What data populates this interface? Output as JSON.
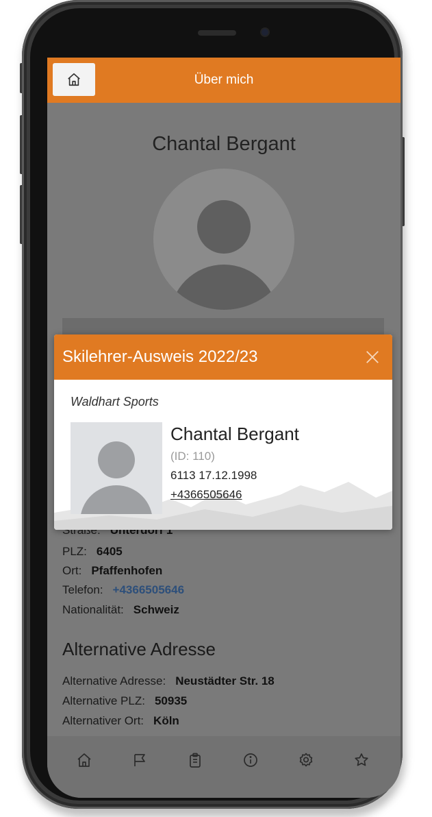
{
  "header": {
    "title": "Über mich"
  },
  "profile": {
    "name": "Chantal Bergant"
  },
  "details": {
    "street_label": "Straße:",
    "street_value": "Unterdorf 1",
    "zip_label": "PLZ:",
    "zip_value": "6405",
    "city_label": "Ort:",
    "city_value": "Pfaffenhofen",
    "phone_label": "Telefon:",
    "phone_value": "+4366505646",
    "nationality_label": "Nationalität:",
    "nationality_value": "Schweiz"
  },
  "alt_address": {
    "title": "Alternative Adresse",
    "address_label": "Alternative Adresse:",
    "address_value": "Neustädter Str. 18",
    "zip_label": "Alternative PLZ:",
    "zip_value": "50935",
    "city_label": "Alternativer Ort:",
    "city_value": "Köln"
  },
  "dialog": {
    "title": "Skilehrer-Ausweis 2022/23",
    "company": "Waldhart Sports",
    "name": "Chantal Bergant",
    "id": "(ID: 110)",
    "line": "6113  17.12.1998",
    "phone": "+4366505646"
  },
  "nav": {
    "items": [
      "home-icon",
      "flag-icon",
      "clipboard-icon",
      "info-icon",
      "settings-icon",
      "star-icon"
    ]
  },
  "colors": {
    "accent": "#e07a22",
    "overlay": "#7a7a7a",
    "link": "#2d4f7a"
  }
}
